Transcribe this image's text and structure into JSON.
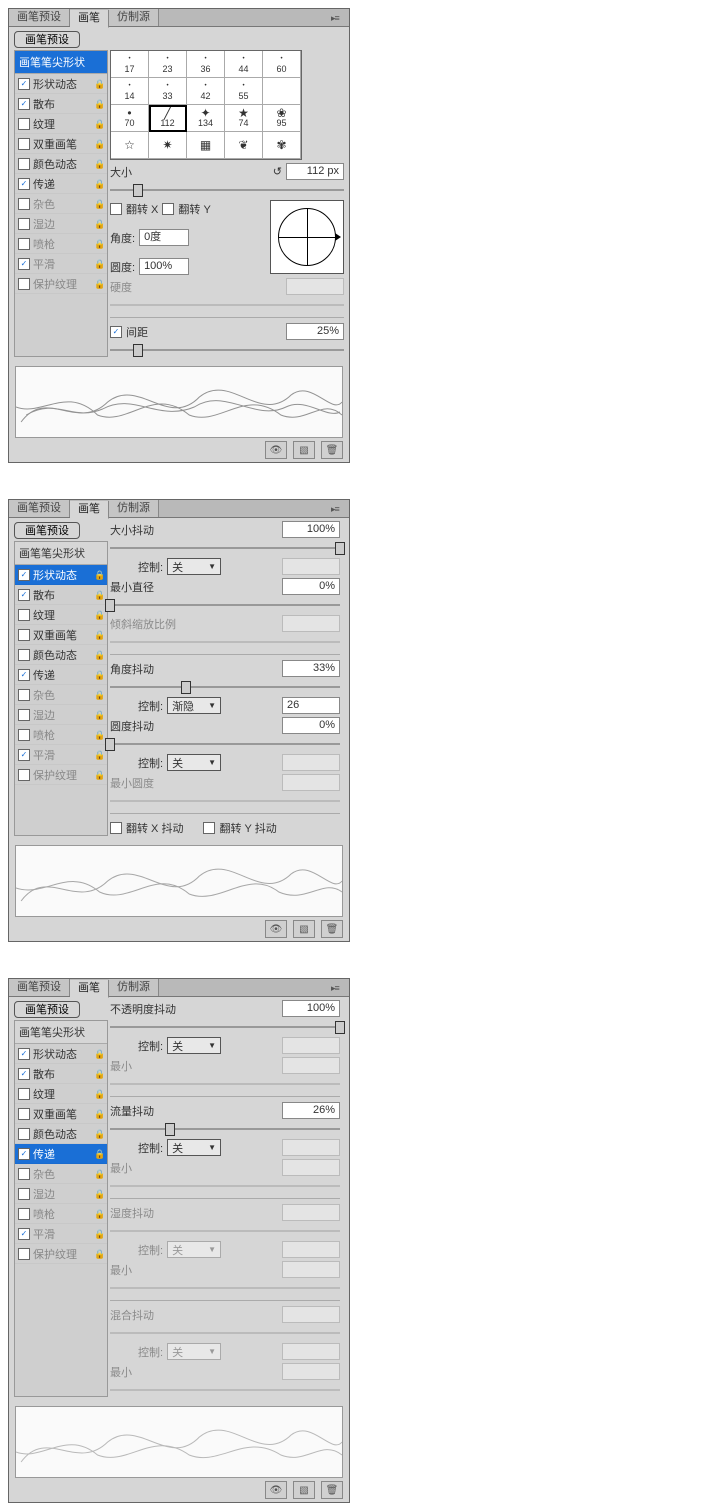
{
  "tabs": [
    "画笔预设",
    "画笔",
    "仿制源"
  ],
  "active_tab": "画笔",
  "preset_button": "画笔预设",
  "sidebar": {
    "head": "画笔笔尖形状",
    "items": [
      {
        "label": "形状动态",
        "checked": true,
        "lock": true,
        "disabled": false
      },
      {
        "label": "散布",
        "checked": true,
        "lock": true,
        "disabled": false
      },
      {
        "label": "纹理",
        "checked": false,
        "lock": true,
        "disabled": false
      },
      {
        "label": "双重画笔",
        "checked": false,
        "lock": true,
        "disabled": false
      },
      {
        "label": "颜色动态",
        "checked": false,
        "lock": true,
        "disabled": false
      },
      {
        "label": "传递",
        "checked": true,
        "lock": true,
        "disabled": false
      },
      {
        "label": "杂色",
        "checked": false,
        "lock": true,
        "disabled": true
      },
      {
        "label": "湿边",
        "checked": false,
        "lock": true,
        "disabled": true
      },
      {
        "label": "喷枪",
        "checked": false,
        "lock": true,
        "disabled": true
      },
      {
        "label": "平滑",
        "checked": true,
        "lock": true,
        "disabled": true
      },
      {
        "label": "保护纹理",
        "checked": false,
        "lock": true,
        "disabled": true
      }
    ]
  },
  "panel1": {
    "selected_item": "画笔笔尖形状",
    "brush_grid": [
      [
        "17",
        "23",
        "36",
        "44",
        "60"
      ],
      [
        "14",
        "33",
        "42",
        "55",
        ""
      ],
      [
        "70",
        "112",
        "134",
        "74",
        "95"
      ],
      [
        "",
        "",
        "",
        "",
        ""
      ]
    ],
    "selected_brush": "112",
    "size_label": "大小",
    "size_value": "112 px",
    "flip_x": "翻转 X",
    "flip_y": "翻转 Y",
    "angle_label": "角度:",
    "angle_value": "0度",
    "round_label": "圆度:",
    "round_value": "100%",
    "hardness_label": "硬度",
    "spacing_label": "间距",
    "spacing_value": "25%",
    "size_slider_pct": 12,
    "spacing_slider_pct": 12
  },
  "panel2": {
    "selected_item": "形状动态",
    "rows": {
      "size_jitter_label": "大小抖动",
      "size_jitter_value": "100%",
      "size_jitter_slider": 100,
      "control_label": "控制:",
      "control1": "关",
      "min_diam_label": "最小直径",
      "min_diam_value": "0%",
      "min_diam_slider": 0,
      "tilt_scale_label": "倾斜缩放比例",
      "angle_jitter_label": "角度抖动",
      "angle_jitter_value": "33%",
      "angle_jitter_slider": 33,
      "control2": "渐隐",
      "control2_value": "26",
      "round_jitter_label": "圆度抖动",
      "round_jitter_value": "0%",
      "round_jitter_slider": 0,
      "control3": "关",
      "min_round_label": "最小圆度",
      "flip_x_jitter": "翻转 X 抖动",
      "flip_y_jitter": "翻转 Y 抖动"
    }
  },
  "panel3": {
    "selected_item": "传递",
    "rows": {
      "opacity_jitter_label": "不透明度抖动",
      "opacity_jitter_value": "100%",
      "opacity_jitter_slider": 100,
      "control_label": "控制:",
      "control1": "关",
      "min_label": "最小",
      "flow_jitter_label": "流量抖动",
      "flow_jitter_value": "26%",
      "flow_jitter_slider": 26,
      "control2": "关",
      "wet_jitter_label": "湿度抖动",
      "control3": "关",
      "mix_jitter_label": "混合抖动",
      "control4": "关"
    }
  }
}
